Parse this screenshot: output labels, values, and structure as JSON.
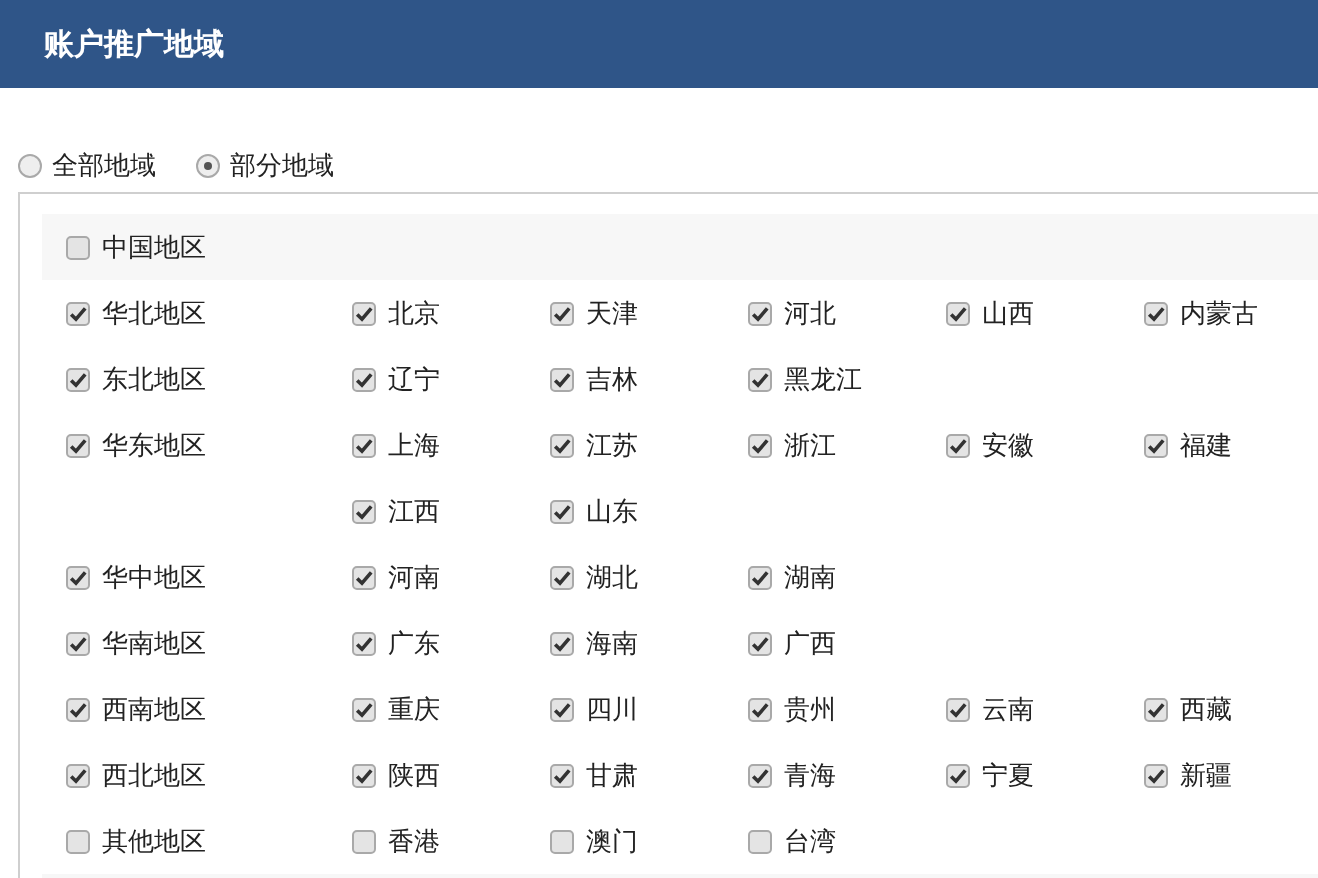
{
  "header": {
    "title": "账户推广地域"
  },
  "scope_options": [
    {
      "label": "全部地域",
      "selected": false
    },
    {
      "label": "部分地域",
      "selected": true
    }
  ],
  "country": {
    "label": "中国地区",
    "checked": false
  },
  "regions": [
    {
      "label": "华北地区",
      "checked": true,
      "provinces": [
        {
          "label": "北京",
          "checked": true
        },
        {
          "label": "天津",
          "checked": true
        },
        {
          "label": "河北",
          "checked": true
        },
        {
          "label": "山西",
          "checked": true
        },
        {
          "label": "内蒙古",
          "checked": true
        }
      ]
    },
    {
      "label": "东北地区",
      "checked": true,
      "provinces": [
        {
          "label": "辽宁",
          "checked": true
        },
        {
          "label": "吉林",
          "checked": true
        },
        {
          "label": "黑龙江",
          "checked": true
        }
      ]
    },
    {
      "label": "华东地区",
      "checked": true,
      "provinces": [
        {
          "label": "上海",
          "checked": true
        },
        {
          "label": "江苏",
          "checked": true
        },
        {
          "label": "浙江",
          "checked": true
        },
        {
          "label": "安徽",
          "checked": true
        },
        {
          "label": "福建",
          "checked": true
        },
        {
          "label": "江西",
          "checked": true
        },
        {
          "label": "山东",
          "checked": true
        }
      ]
    },
    {
      "label": "华中地区",
      "checked": true,
      "provinces": [
        {
          "label": "河南",
          "checked": true
        },
        {
          "label": "湖北",
          "checked": true
        },
        {
          "label": "湖南",
          "checked": true
        }
      ]
    },
    {
      "label": "华南地区",
      "checked": true,
      "provinces": [
        {
          "label": "广东",
          "checked": true
        },
        {
          "label": "海南",
          "checked": true
        },
        {
          "label": "广西",
          "checked": true
        }
      ]
    },
    {
      "label": "西南地区",
      "checked": true,
      "provinces": [
        {
          "label": "重庆",
          "checked": true
        },
        {
          "label": "四川",
          "checked": true
        },
        {
          "label": "贵州",
          "checked": true
        },
        {
          "label": "云南",
          "checked": true
        },
        {
          "label": "西藏",
          "checked": true
        }
      ]
    },
    {
      "label": "西北地区",
      "checked": true,
      "provinces": [
        {
          "label": "陕西",
          "checked": true
        },
        {
          "label": "甘肃",
          "checked": true
        },
        {
          "label": "青海",
          "checked": true
        },
        {
          "label": "宁夏",
          "checked": true
        },
        {
          "label": "新疆",
          "checked": true
        }
      ]
    },
    {
      "label": "其他地区",
      "checked": false,
      "provinces": [
        {
          "label": "香港",
          "checked": false
        },
        {
          "label": "澳门",
          "checked": false
        },
        {
          "label": "台湾",
          "checked": false
        }
      ]
    }
  ]
}
